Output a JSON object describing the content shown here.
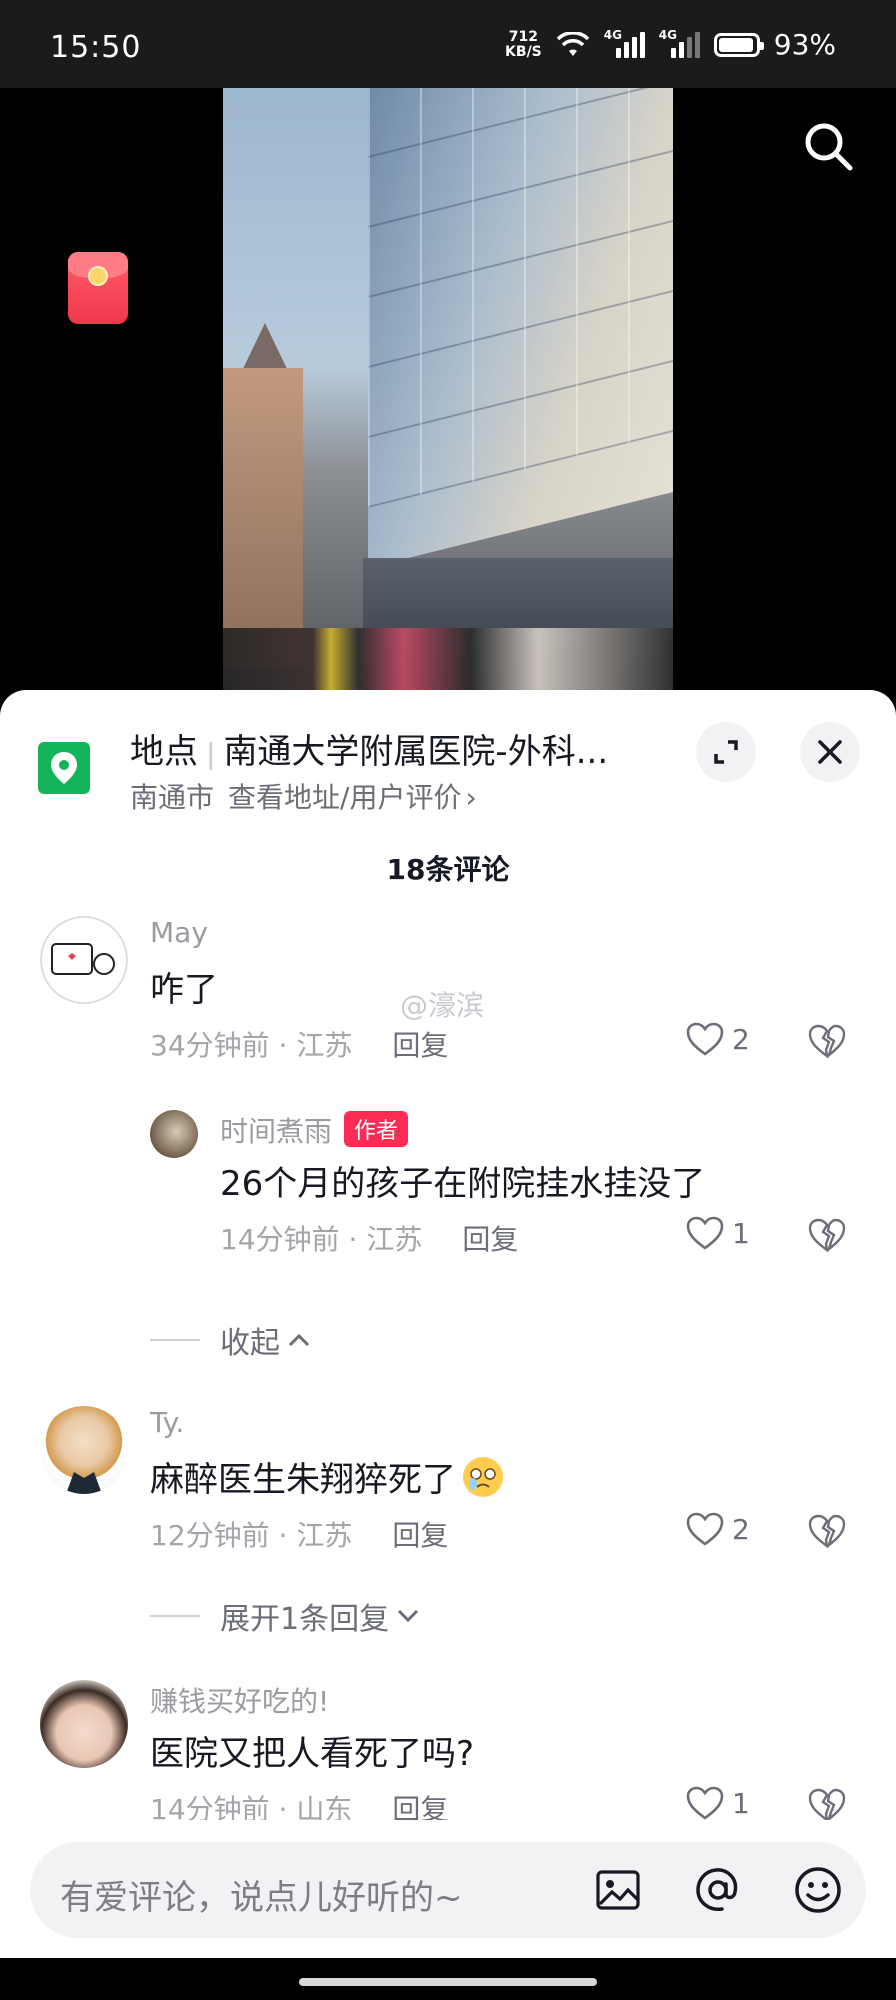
{
  "status": {
    "time": "15:50",
    "net_speed_value": "712",
    "net_speed_unit": "KB/S",
    "signal_label": "4G",
    "battery": "93%"
  },
  "icons": {
    "search": "search-icon",
    "red_envelope": "red-envelope-icon",
    "location": "location-pin-icon",
    "expand": "expand-icon",
    "close": "close-icon",
    "heart": "heart-icon",
    "dislike": "broken-heart-icon",
    "image": "image-icon",
    "at": "at-icon",
    "emoji": "emoji-icon"
  },
  "location": {
    "label": "地点",
    "name": "南通大学附属医院-外科...",
    "city": "南通市",
    "link": "查看地址/用户评价"
  },
  "comment_count": "18条评论",
  "watermark": "@濠滨",
  "comments": [
    {
      "user": "May",
      "text": "咋了",
      "time": "34分钟前 · 江苏",
      "reply": "回复",
      "likes": "2"
    },
    {
      "user": "时间煮雨",
      "badge": "作者",
      "text": "26个月的孩子在附院挂水挂没了",
      "time": "14分钟前 · 江苏",
      "reply": "回复",
      "likes": "1"
    },
    {
      "user": "Ty.",
      "text": "麻醉医生朱翔猝死了",
      "time": "12分钟前 · 江苏",
      "reply": "回复",
      "likes": "2"
    },
    {
      "user": "赚钱买好吃的!",
      "text": "医院又把人看死了吗?",
      "time": "14分钟前 · 山东",
      "reply": "回复",
      "likes": "1"
    }
  ],
  "collapse_label": "收起",
  "expand_replies_label": "展开1条回复",
  "input": {
    "placeholder": "有爱评论，说点儿好听的~"
  },
  "colors": {
    "accent": "#fe2c55",
    "location_green": "#14b45a"
  }
}
